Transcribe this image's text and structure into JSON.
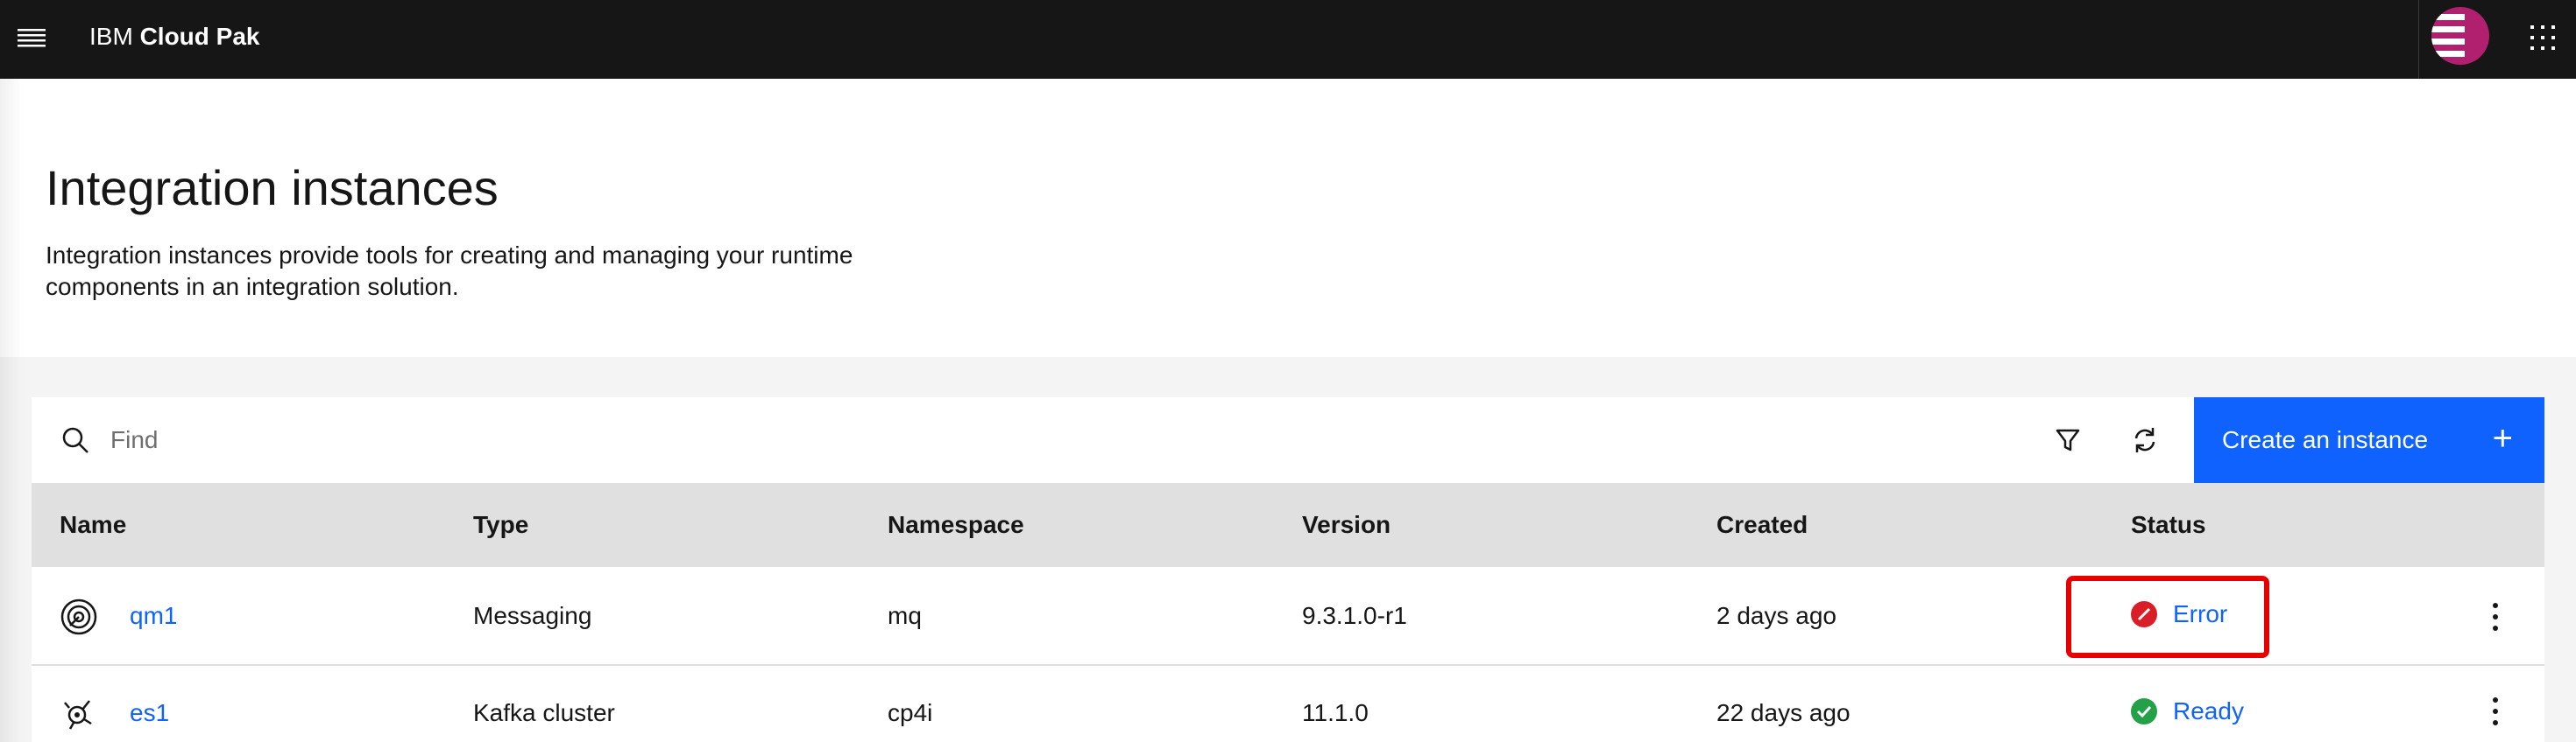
{
  "header": {
    "brand_prefix": "IBM",
    "brand_product": "Cloud Pak",
    "menu_icon": "hamburger-menu-icon",
    "switcher_icon": "app-switcher-icon",
    "avatar_color": "#b0206f"
  },
  "page": {
    "title": "Integration instances",
    "description": "Integration instances provide tools for creating and managing your runtime components in an integration solution."
  },
  "toolbar": {
    "search_placeholder": "Find",
    "create_label": "Create an instance",
    "create_icon": "+",
    "accent": "#0f62fe"
  },
  "table": {
    "columns": [
      "Name",
      "Type",
      "Namespace",
      "Version",
      "Created",
      "Status"
    ],
    "rows": [
      {
        "name": "qm1",
        "icon": "messaging-icon",
        "type": "Messaging",
        "namespace": "mq",
        "version": "9.3.1.0-r1",
        "created": "2 days ago",
        "status": "Error",
        "status_color": "#da1e28"
      },
      {
        "name": "es1",
        "icon": "kafka-cluster-icon",
        "type": "Kafka cluster",
        "namespace": "cp4i",
        "version": "11.1.0",
        "created": "22 days ago",
        "status": "Ready",
        "status_color": "#24a148"
      }
    ]
  }
}
